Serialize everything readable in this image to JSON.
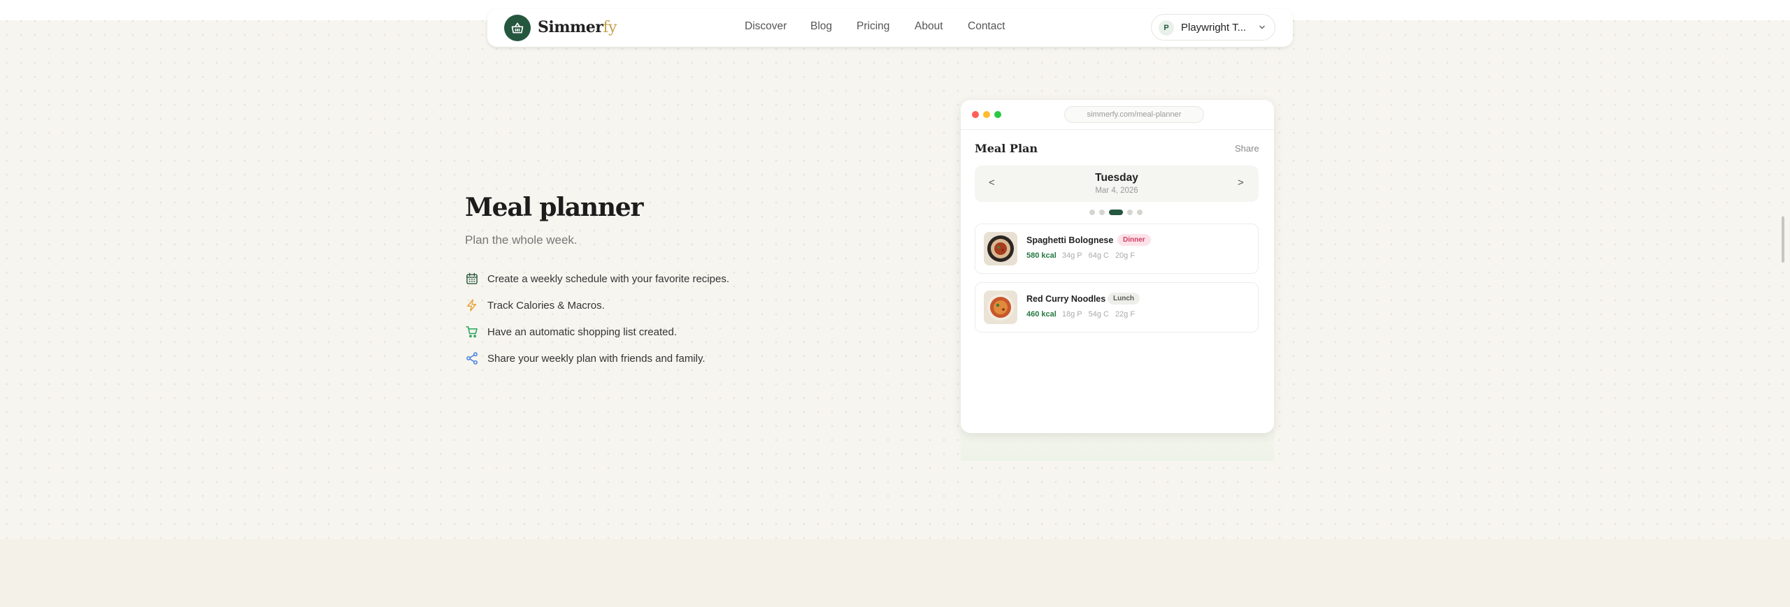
{
  "brand": {
    "name_a": "Simmer",
    "name_b": "fy"
  },
  "nav": {
    "links": [
      "Discover",
      "Blog",
      "Pricing",
      "About",
      "Contact"
    ],
    "user_initial": "P",
    "user_name": "Playwright T..."
  },
  "hero": {
    "title": "Meal planner",
    "subtitle": "Plan the whole week.",
    "features": [
      {
        "icon": "calendar-icon",
        "text": "Create a weekly schedule with your favorite recipes."
      },
      {
        "icon": "lightning-icon",
        "text": "Track Calories & Macros."
      },
      {
        "icon": "cart-icon",
        "text": "Have an automatic shopping list created."
      },
      {
        "icon": "share-icon",
        "text": "Share your weekly plan with friends and family."
      }
    ]
  },
  "mock": {
    "url": "simmerfy.com/meal-planner",
    "title": "Meal Plan",
    "share": "Share",
    "prev": "<",
    "next": ">",
    "day": "Tuesday",
    "date": "Mar 4, 2026",
    "page_count": 5,
    "active_page": 3,
    "meals": [
      {
        "name": "Spaghetti Bolognese",
        "tag": "Dinner",
        "kcal": "580 kcal",
        "protein": "34g P",
        "carbs": "64g C",
        "fat": "20g F"
      },
      {
        "name": "Red Curry Noodles",
        "tag": "Lunch",
        "kcal": "460 kcal",
        "protein": "18g P",
        "carbs": "54g C",
        "fat": "22g F"
      }
    ]
  },
  "colors": {
    "brand_green": "#25573f",
    "accent_gold": "#c6a24c",
    "dinner_tag": "#d03c63",
    "kcal_green": "#25773f",
    "traffic_red": "#ff5f57",
    "traffic_yellow": "#febc2e",
    "traffic_green": "#28c840"
  }
}
